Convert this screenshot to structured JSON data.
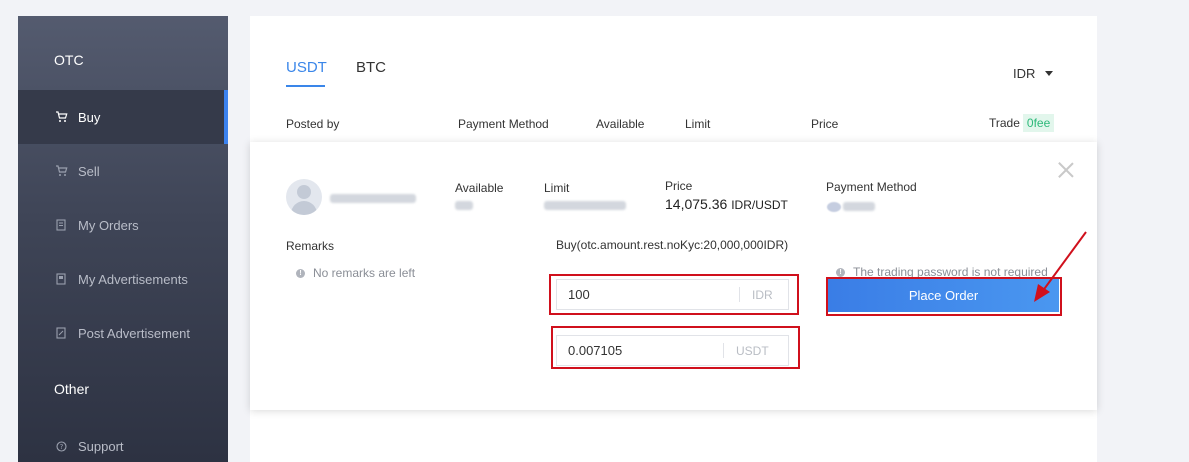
{
  "sidebar": {
    "section_otc": "OTC",
    "section_other": "Other",
    "items": [
      {
        "label": "Buy",
        "icon": "cart-icon"
      },
      {
        "label": "Sell",
        "icon": "cart-icon"
      },
      {
        "label": "My Orders",
        "icon": "document-icon"
      },
      {
        "label": "My Advertisements",
        "icon": "advert-icon"
      },
      {
        "label": "Post Advertisement",
        "icon": "edit-icon"
      },
      {
        "label": "Support",
        "icon": "help-icon"
      }
    ]
  },
  "tabs": [
    {
      "label": "USDT",
      "active": true
    },
    {
      "label": "BTC",
      "active": false
    }
  ],
  "currency_select": {
    "value": "IDR"
  },
  "table_headers": {
    "posted_by": "Posted by",
    "payment_method": "Payment Method",
    "available": "Available",
    "limit": "Limit",
    "price": "Price",
    "trade": "Trade",
    "fee_badge": "0fee"
  },
  "order": {
    "available_label": "Available",
    "limit_label": "Limit",
    "price_label": "Price",
    "price_value": "14,075.36",
    "price_unit": "IDR/USDT",
    "payment_method_label": "Payment Method",
    "remarks_label": "Remarks",
    "remarks_note": "No remarks are left",
    "buy_limit_text": "Buy(otc.amount.rest.noKyc:20,000,000IDR)",
    "amount_idr": "100",
    "amount_idr_unit": "IDR",
    "amount_usdt": "0.007105",
    "amount_usdt_unit": "USDT",
    "password_note": "The trading password is not required",
    "place_order_label": "Place Order"
  },
  "colors": {
    "accent": "#3a86e9",
    "highlight": "#d0101c",
    "fee_green": "#2db97a"
  }
}
